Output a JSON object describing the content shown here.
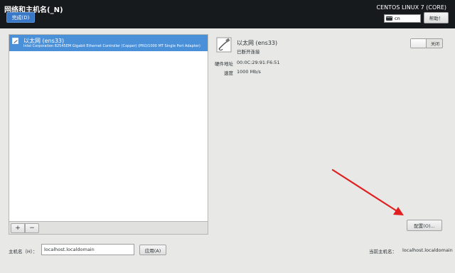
{
  "header": {
    "title": "网络和主机名(_N)",
    "done_label": "完成(D)",
    "product": "CENTOS LINUX 7 (CORE)",
    "keyboard_layout": "cn",
    "help_label": "帮助！"
  },
  "device_list": {
    "items": [
      {
        "name": "以太网 (ens33)",
        "description": "Intel Corporation 82545EM Gigabit Ethernet Controller (Copper) (PRO/1000 MT Single Port Adapter)"
      }
    ],
    "add_label": "+",
    "remove_label": "−"
  },
  "device_detail": {
    "name": "以太网 (ens33)",
    "status": "已断开连接",
    "switch_label": "关闭",
    "switch_on": false,
    "properties": [
      {
        "label": "硬件地址",
        "value": "00:0C:29:91:F6:51"
      },
      {
        "label": "速度",
        "value": "1000 Mb/s"
      }
    ],
    "configure_label": "配置(O)..."
  },
  "hostname": {
    "label": "主机名（H）：",
    "value": "localhost.localdomain",
    "apply_label": "应用(A)",
    "current_label": "当前主机名：",
    "current_value": "localhost.localdomain"
  },
  "colors": {
    "header_bg": "#171a1c",
    "accent": "#4a90d9",
    "annotation_arrow": "#e02020"
  }
}
